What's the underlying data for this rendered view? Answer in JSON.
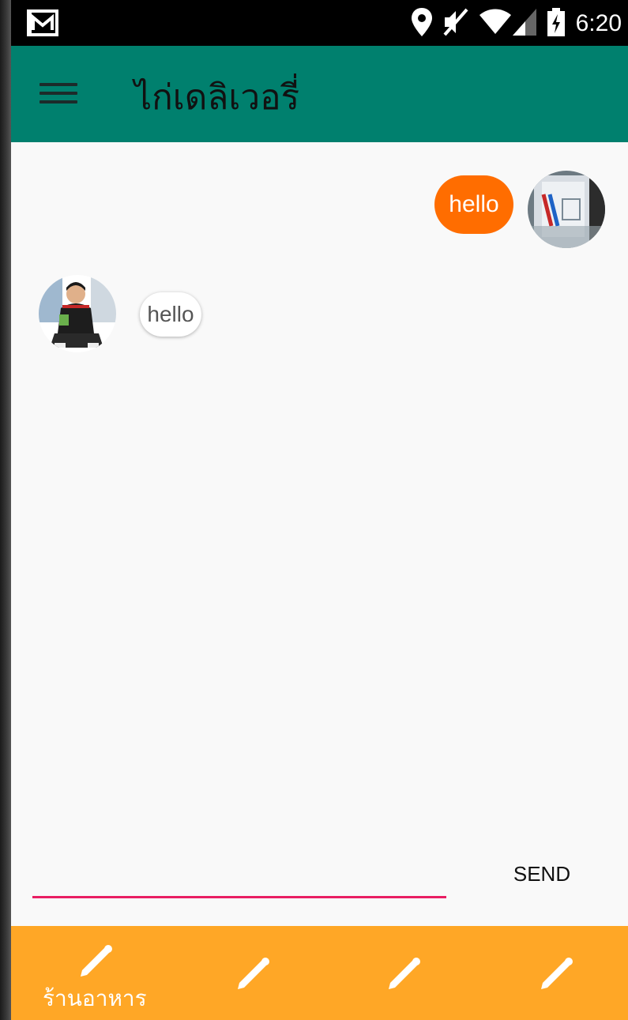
{
  "status_bar": {
    "time": "6:20",
    "icons": [
      "gmail-icon",
      "location-icon",
      "mute-icon",
      "wifi-icon",
      "signal-icon",
      "battery-charging-icon"
    ]
  },
  "app_bar": {
    "title": "ไก่เดลิเวอรี่",
    "menu_icon": "hamburger-menu-icon"
  },
  "messages": [
    {
      "direction": "outgoing",
      "text": "hello",
      "color": "#ff6d00"
    },
    {
      "direction": "incoming",
      "text": "hello",
      "color": "#ffffff"
    }
  ],
  "composer": {
    "input_value": "",
    "send_label": "SEND",
    "underline_color": "#e91e63"
  },
  "bottom_nav": {
    "color": "#ffa726",
    "items": [
      {
        "label": "ร้านอาหาร",
        "icon": "pencil-icon"
      },
      {
        "label": "",
        "icon": "pencil-icon"
      },
      {
        "label": "",
        "icon": "pencil-icon"
      },
      {
        "label": "",
        "icon": "pencil-icon"
      }
    ]
  },
  "colors": {
    "app_bar": "#00806e",
    "status_bar": "#000000",
    "background": "#f9f9f9"
  }
}
